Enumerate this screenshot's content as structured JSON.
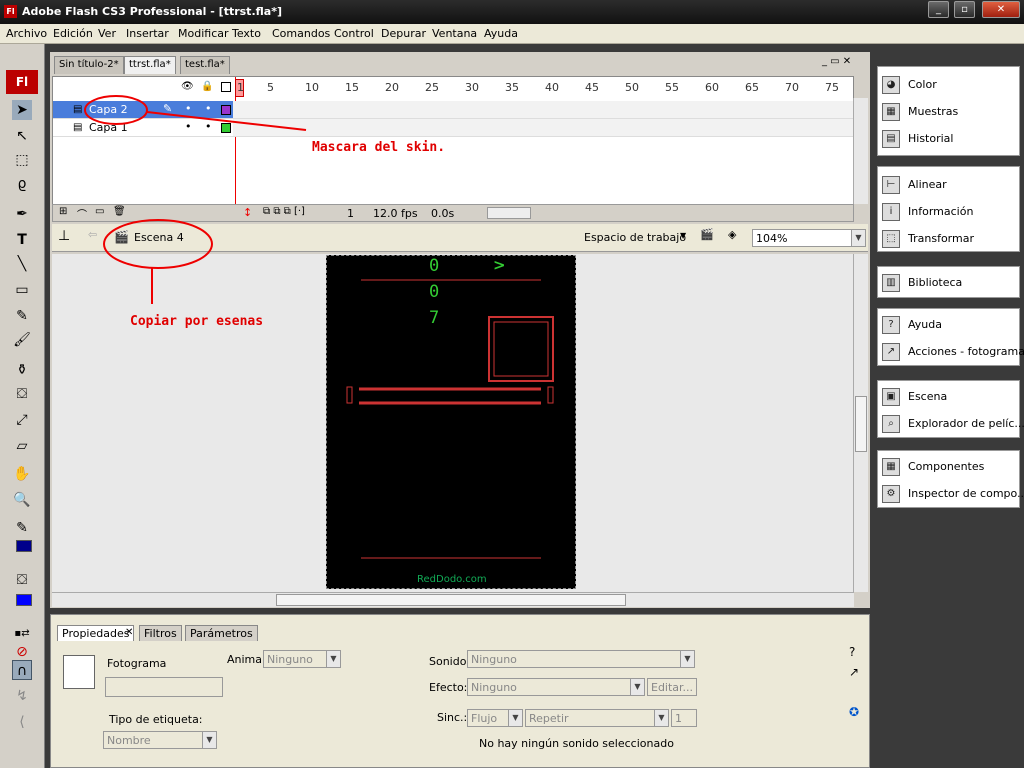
{
  "window": {
    "title": "Adobe Flash CS3 Professional - [ttrst.fla*]",
    "app_icon": "Fl"
  },
  "menu": [
    "Archivo",
    "Edición",
    "Ver",
    "Insertar",
    "Modificar",
    "Texto",
    "Comandos",
    "Control",
    "Depurar",
    "Ventana",
    "Ayuda"
  ],
  "doc_tabs": [
    "Sin título-2*",
    "ttrst.fla*",
    "test.fla*"
  ],
  "timeline": {
    "frame_numbers": [
      "1",
      "5",
      "10",
      "15",
      "20",
      "25",
      "30",
      "35",
      "40",
      "45",
      "50",
      "55",
      "60",
      "65",
      "70",
      "75"
    ],
    "layers": [
      {
        "name": "Capa 2",
        "color": "#9933cc"
      },
      {
        "name": "Capa 1",
        "color": "#33cc33"
      }
    ],
    "current_frame": "1",
    "fps": "12.0 fps",
    "time": "0.0s"
  },
  "scene": {
    "name": "Escena 4",
    "workspace": "Espacio de trabajo",
    "zoom": "104%"
  },
  "stage": {
    "watermark": "RedDodo.com",
    "glyphs": [
      "0",
      "0",
      "7",
      ">"
    ]
  },
  "annotations": {
    "mask": "Mascara del skin.",
    "copy": "Copiar por esenas"
  },
  "properties": {
    "tabs": [
      "Propiedades",
      "Filtros",
      "Parámetros"
    ],
    "frame_label": "Fotograma",
    "animar_label": "Animar:",
    "animar_value": "Ninguno",
    "tipo_label": "Tipo de etiqueta:",
    "tipo_value": "Nombre",
    "sonido_label": "Sonido:",
    "sonido_value": "Ninguno",
    "efecto_label": "Efecto:",
    "efecto_value": "Ninguno",
    "editar": "Editar...",
    "sinc_label": "Sinc.:",
    "sinc_value": "Flujo",
    "repetir_value": "Repetir",
    "repetir_count": "1",
    "status": "No hay ningún sonido seleccionado"
  },
  "right_panel": {
    "groups": [
      [
        "Color",
        "Muestras",
        "Historial"
      ],
      [
        "Alinear",
        "Información",
        "Transformar"
      ],
      [
        "Biblioteca"
      ],
      [
        "Ayuda",
        "Acciones - fotograma"
      ],
      [
        "Escena",
        "Explorador de pelíc..."
      ],
      [
        "Componentes",
        "Inspector de compo..."
      ]
    ]
  }
}
